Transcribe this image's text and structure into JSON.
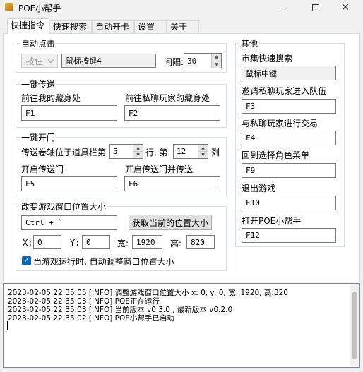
{
  "window": {
    "title": "POE小帮手"
  },
  "tabs": [
    {
      "label": "快捷指令"
    },
    {
      "label": "快速搜索"
    },
    {
      "label": "自动开卡"
    },
    {
      "label": "设置"
    },
    {
      "label": "关于"
    }
  ],
  "auto_click": {
    "title": "自动点击",
    "mode_label": "按住",
    "key_value": "鼠标按键4",
    "interval_label": "间隔:",
    "interval_value": "30"
  },
  "quick_travel": {
    "title": "一键传送",
    "my_hideout_label": "前往我的藏身处",
    "my_hideout_key": "F1",
    "pm_hideout_label": "前往私聊玩家的藏身处",
    "pm_hideout_key": "F2"
  },
  "open_portal": {
    "title": "一键开门",
    "scroll_pos_label": "传送卷轴位于道具栏第",
    "row_value": "5",
    "row_label": "行, 第",
    "col_value": "12",
    "col_label": "列",
    "open_label": "开启传送门",
    "open_key": "F5",
    "open_travel_label": "开启传送门并传送",
    "open_travel_key": "F6"
  },
  "window_size": {
    "title": "改变游戏窗口位置大小",
    "hotkey": "Ctrl + `",
    "get_button": "获取当前的位置大小",
    "x_label": "X:",
    "x_value": "0",
    "y_label": "Y:",
    "y_value": "0",
    "w_label": "宽:",
    "w_value": "1920",
    "h_label": "高:",
    "h_value": "820",
    "auto_adjust_label": "当游戏运行时, 自动调整窗口位置大小",
    "auto_adjust_checked": true
  },
  "other": {
    "title": "其他",
    "market_search_label": "市集快速搜索",
    "market_search_key": "鼠标中键",
    "invite_label": "邀请私聊玩家进入队伍",
    "invite_key": "F3",
    "trade_label": "与私聊玩家进行交易",
    "trade_key": "F4",
    "char_select_label": "回到选择角色菜单",
    "char_select_key": "F9",
    "exit_label": "退出游戏",
    "exit_key": "F10",
    "open_helper_label": "打开POE小帮手",
    "open_helper_key": "F12"
  },
  "log": [
    "2023-02-05 22:35:05 [INFO] 调整游戏窗口位置大小 x: 0, y: 0, 宽: 1920, 高:820",
    "2023-02-05 22:35:03 [INFO] POE正在运行",
    "2023-02-05 22:35:03 [INFO] 当前版本 v0.3.0 , 最新版本 v0.2.0",
    "2023-02-05 22:35:02 [INFO] POE小帮手已启动"
  ],
  "colors": {
    "accent": "#0067c0",
    "window_bg": "#f0f0f0",
    "panel_bg": "#ffffff"
  }
}
